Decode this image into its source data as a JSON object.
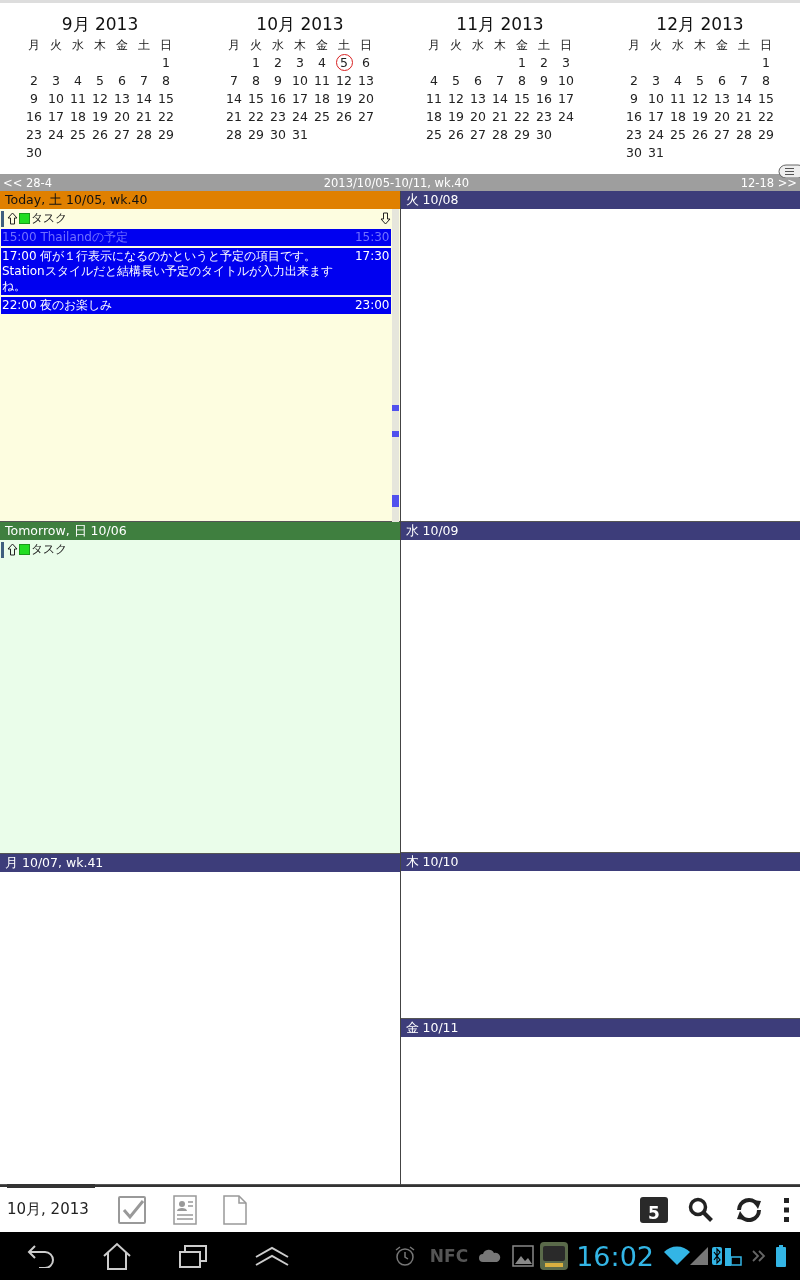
{
  "mini_calendar": {
    "months": [
      {
        "title": "9月 2013",
        "weekdays": [
          "月",
          "火",
          "水",
          "木",
          "金",
          "土",
          "日"
        ],
        "weeks": [
          [
            {
              "day": "1",
              "today": false
            }
          ],
          [
            {
              "day": "2",
              "today": false
            },
            {
              "day": "3",
              "today": false
            },
            {
              "day": "4",
              "today": false
            },
            {
              "day": "5",
              "today": false
            },
            {
              "day": "6",
              "today": false
            },
            {
              "day": "7",
              "today": false
            },
            {
              "day": "8",
              "today": false
            }
          ],
          [
            {
              "day": "9",
              "today": false
            },
            {
              "day": "10",
              "today": false
            },
            {
              "day": "11",
              "today": false
            },
            {
              "day": "12",
              "today": false
            },
            {
              "day": "13",
              "today": false
            },
            {
              "day": "14",
              "today": false
            },
            {
              "day": "15",
              "today": false
            }
          ],
          [
            {
              "day": "16",
              "today": false
            },
            {
              "day": "17",
              "today": false
            },
            {
              "day": "18",
              "today": false
            },
            {
              "day": "19",
              "today": false
            },
            {
              "day": "20",
              "today": false
            },
            {
              "day": "21",
              "today": false
            },
            {
              "day": "22",
              "today": false
            }
          ],
          [
            {
              "day": "23",
              "today": false
            },
            {
              "day": "24",
              "today": false
            },
            {
              "day": "25",
              "today": false
            },
            {
              "day": "26",
              "today": false
            },
            {
              "day": "27",
              "today": false
            },
            {
              "day": "28",
              "today": false
            },
            {
              "day": "29",
              "today": false
            }
          ],
          [
            {
              "day": "30",
              "today": false
            }
          ]
        ]
      },
      {
        "title": "10月 2013",
        "weekdays": [
          "月",
          "火",
          "水",
          "木",
          "金",
          "土",
          "日"
        ],
        "weeks": [
          [
            {
              "day": "1",
              "today": false
            },
            {
              "day": "2",
              "today": false
            },
            {
              "day": "3",
              "today": false
            },
            {
              "day": "4",
              "today": false
            },
            {
              "day": "5",
              "today": true
            },
            {
              "day": "6",
              "today": false
            }
          ],
          [
            {
              "day": "7",
              "today": false
            },
            {
              "day": "8",
              "today": false
            },
            {
              "day": "9",
              "today": false
            },
            {
              "day": "10",
              "today": false
            },
            {
              "day": "11",
              "today": false
            },
            {
              "day": "12",
              "today": false
            },
            {
              "day": "13",
              "today": false
            }
          ],
          [
            {
              "day": "14",
              "today": false
            },
            {
              "day": "15",
              "today": false
            },
            {
              "day": "16",
              "today": false
            },
            {
              "day": "17",
              "today": false
            },
            {
              "day": "18",
              "today": false
            },
            {
              "day": "19",
              "today": false
            },
            {
              "day": "20",
              "today": false
            }
          ],
          [
            {
              "day": "21",
              "today": false
            },
            {
              "day": "22",
              "today": false
            },
            {
              "day": "23",
              "today": false
            },
            {
              "day": "24",
              "today": false
            },
            {
              "day": "25",
              "today": false
            },
            {
              "day": "26",
              "today": false
            },
            {
              "day": "27",
              "today": false
            }
          ],
          [
            {
              "day": "28",
              "today": false
            },
            {
              "day": "29",
              "today": false
            },
            {
              "day": "30",
              "today": false
            },
            {
              "day": "31",
              "today": false
            }
          ]
        ]
      },
      {
        "title": "11月 2013",
        "weekdays": [
          "月",
          "火",
          "水",
          "木",
          "金",
          "土",
          "日"
        ],
        "weeks": [
          [
            {
              "day": "1",
              "today": false
            },
            {
              "day": "2",
              "today": false
            },
            {
              "day": "3",
              "today": false
            }
          ],
          [
            {
              "day": "4",
              "today": false
            },
            {
              "day": "5",
              "today": false
            },
            {
              "day": "6",
              "today": false
            },
            {
              "day": "7",
              "today": false
            },
            {
              "day": "8",
              "today": false
            },
            {
              "day": "9",
              "today": false
            },
            {
              "day": "10",
              "today": false
            }
          ],
          [
            {
              "day": "11",
              "today": false
            },
            {
              "day": "12",
              "today": false
            },
            {
              "day": "13",
              "today": false
            },
            {
              "day": "14",
              "today": false
            },
            {
              "day": "15",
              "today": false
            },
            {
              "day": "16",
              "today": false
            },
            {
              "day": "17",
              "today": false
            }
          ],
          [
            {
              "day": "18",
              "today": false
            },
            {
              "day": "19",
              "today": false
            },
            {
              "day": "20",
              "today": false
            },
            {
              "day": "21",
              "today": false
            },
            {
              "day": "22",
              "today": false
            },
            {
              "day": "23",
              "today": false
            },
            {
              "day": "24",
              "today": false
            }
          ],
          [
            {
              "day": "25",
              "today": false
            },
            {
              "day": "26",
              "today": false
            },
            {
              "day": "27",
              "today": false
            },
            {
              "day": "28",
              "today": false
            },
            {
              "day": "29",
              "today": false
            },
            {
              "day": "30",
              "today": false
            }
          ]
        ]
      },
      {
        "title": "12月 2013",
        "weekdays": [
          "月",
          "火",
          "水",
          "木",
          "金",
          "土",
          "日"
        ],
        "weeks": [
          [
            {
              "day": "1",
              "today": false
            }
          ],
          [
            {
              "day": "2",
              "today": false
            },
            {
              "day": "3",
              "today": false
            },
            {
              "day": "4",
              "today": false
            },
            {
              "day": "5",
              "today": false
            },
            {
              "day": "6",
              "today": false
            },
            {
              "day": "7",
              "today": false
            },
            {
              "day": "8",
              "today": false
            }
          ],
          [
            {
              "day": "9",
              "today": false
            },
            {
              "day": "10",
              "today": false
            },
            {
              "day": "11",
              "today": false
            },
            {
              "day": "12",
              "today": false
            },
            {
              "day": "13",
              "today": false
            },
            {
              "day": "14",
              "today": false
            },
            {
              "day": "15",
              "today": false
            }
          ],
          [
            {
              "day": "16",
              "today": false
            },
            {
              "day": "17",
              "today": false
            },
            {
              "day": "18",
              "today": false
            },
            {
              "day": "19",
              "today": false
            },
            {
              "day": "20",
              "today": false
            },
            {
              "day": "21",
              "today": false
            },
            {
              "day": "22",
              "today": false
            }
          ],
          [
            {
              "day": "23",
              "today": false
            },
            {
              "day": "24",
              "today": false
            },
            {
              "day": "25",
              "today": false
            },
            {
              "day": "26",
              "today": false
            },
            {
              "day": "27",
              "today": false
            },
            {
              "day": "28",
              "today": false
            },
            {
              "day": "29",
              "today": false
            }
          ],
          [
            {
              "day": "30",
              "today": false
            },
            {
              "day": "31",
              "today": false
            }
          ]
        ]
      }
    ]
  },
  "week_nav": {
    "prev": "<< 28-4",
    "range": "2013/10/05-10/11, wk.40",
    "next": "12-18 >>"
  },
  "week_view": {
    "columns": [
      {
        "days": [
          {
            "kind": "today",
            "header": "Today, 土 10/05, wk.40",
            "items": [
              {
                "kind": "task",
                "title": "タスク",
                "checked": false,
                "arrow_down": true
              },
              {
                "kind": "event",
                "start": "15:00",
                "title": "Thailandの予定",
                "end": "15:30",
                "past": true
              },
              {
                "kind": "event",
                "start": "17:00",
                "title": "何が１行表示になるのかというと予定の項目です。Stationスタイルだと結構長い予定のタイトルが入力出来ますね。",
                "end": "17:30",
                "past": false
              },
              {
                "kind": "event",
                "start": "22:00",
                "title": "夜のお楽しみ",
                "end": "23:00",
                "past": false
              }
            ]
          },
          {
            "kind": "tomorrow",
            "header": "Tomorrow, 日 10/06",
            "items": [
              {
                "kind": "task",
                "title": "タスク",
                "checked": false,
                "arrow_down": false
              }
            ]
          },
          {
            "kind": "normal",
            "header": "月 10/07, wk.41"
          }
        ]
      },
      {
        "days": [
          {
            "kind": "normal",
            "header": "火 10/08"
          },
          {
            "kind": "normal",
            "header": "水 10/09"
          },
          {
            "kind": "normal",
            "header": "木 10/10"
          },
          {
            "kind": "normal",
            "header": "金 10/11"
          }
        ]
      }
    ]
  },
  "toolbar": {
    "month_label": "10月, 2013",
    "today_badge": "5"
  },
  "system_bar": {
    "nfc_label": "NFC",
    "time": "16:02"
  }
}
